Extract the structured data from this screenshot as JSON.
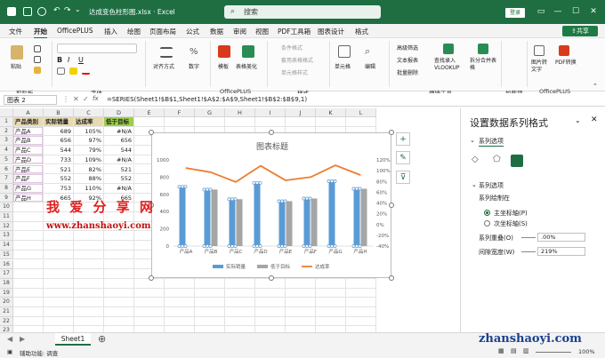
{
  "window": {
    "title": "达成变色柱形图.xlsx · Excel",
    "search_placeholder": "搜索",
    "login": "登录"
  },
  "menu": {
    "items": [
      "文件",
      "开始",
      "OfficePLUS",
      "插入",
      "绘图",
      "页面布局",
      "公式",
      "数据",
      "审阅",
      "视图",
      "PDF工具箱",
      "图表设计",
      "格式"
    ],
    "active": "开始",
    "share": "共享"
  },
  "ribbon": {
    "paste": "粘贴",
    "clipboard": "剪贴板",
    "font": "字体",
    "align": "对齐方式",
    "number": "数字",
    "template": "模板",
    "beautify": "表格美化",
    "officeplus": "OfficePLUS",
    "cond_format": "条件格式",
    "table_format": "套用表格格式",
    "cell_style": "单元格样式",
    "styles": "样式",
    "cells": "单元格",
    "edit": "编辑",
    "adv_filter": "高级筛选",
    "text_replace": "文本报表",
    "batch": "批量删除",
    "tools": "便捷工具",
    "vlookup": "查找录入 VLOOKUP",
    "split": "拆分合并表格",
    "addin": "加载项",
    "img_to_text": "图片转文字",
    "pdf_convert": "PDF转换",
    "officeplus2": "OfficePLUS"
  },
  "formula_bar": {
    "name_box": "图表 2",
    "fx": "fx",
    "formula": "=SERIES(Sheet1!$B$1,Sheet1!$A$2:$A$9,Sheet1!$B$2:$B$9,1)"
  },
  "grid": {
    "columns": [
      "A",
      "B",
      "C",
      "D",
      "E",
      "F",
      "G",
      "H",
      "I",
      "J",
      "K",
      "L"
    ],
    "rows": [
      "1",
      "2",
      "3",
      "4",
      "5",
      "6",
      "7",
      "8",
      "9",
      "10",
      "11",
      "12",
      "13",
      "14",
      "15",
      "16",
      "17",
      "18",
      "19",
      "20",
      "21",
      "22",
      "23"
    ],
    "header": [
      "产品类别",
      "实际销量",
      "达成率",
      "低于目标"
    ],
    "data": [
      [
        "产品A",
        "689",
        "105%",
        "#N/A"
      ],
      [
        "产品B",
        "656",
        "97%",
        "656"
      ],
      [
        "产品C",
        "544",
        "79%",
        "544"
      ],
      [
        "产品D",
        "733",
        "109%",
        "#N/A"
      ],
      [
        "产品E",
        "521",
        "82%",
        "521"
      ],
      [
        "产品F",
        "552",
        "88%",
        "552"
      ],
      [
        "产品G",
        "753",
        "110%",
        "#N/A"
      ],
      [
        "产品H",
        "665",
        "92%",
        "665"
      ]
    ]
  },
  "chart_data": {
    "type": "bar",
    "title": "图表标题",
    "categories": [
      "产品A",
      "产品B",
      "产品C",
      "产品D",
      "产品E",
      "产品F",
      "产品G",
      "产品H"
    ],
    "series": [
      {
        "name": "实际销量",
        "values": [
          689,
          656,
          544,
          733,
          521,
          552,
          753,
          665
        ],
        "color": "#5b9bd5",
        "type": "bar"
      },
      {
        "name": "低于目标",
        "values": [
          null,
          656,
          544,
          null,
          521,
          552,
          null,
          665
        ],
        "color": "#a5a5a5",
        "type": "bar"
      },
      {
        "name": "达成率",
        "values": [
          105,
          97,
          79,
          109,
          82,
          88,
          110,
          92
        ],
        "color": "#ed7d31",
        "type": "line",
        "axis": "secondary"
      }
    ],
    "ylim": [
      0,
      1000
    ],
    "yticks": [
      "0",
      "200",
      "400",
      "600",
      "800",
      "1000"
    ],
    "y2lim": [
      -40,
      120
    ],
    "y2ticks": [
      "-40%",
      "-20%",
      "0%",
      "20%",
      "40%",
      "60%",
      "80%",
      "100%",
      "120%"
    ],
    "legend": "bottom"
  },
  "watermark": {
    "cn": "我 爱 分 享 网",
    "url": "www.zhanshaoyi.com",
    "url2": "zhanshaoyi.com"
  },
  "pane": {
    "title": "设置数据系列格式",
    "options_label": "系列选项",
    "section": "系列选项",
    "plot_on": "系列绘制在",
    "primary": "主坐标轴(P)",
    "secondary": "次坐标轴(S)",
    "overlap_label": "系列重叠(O)",
    "overlap_value": ".00%",
    "gap_label": "间隙宽度(W)",
    "gap_value": "219%"
  },
  "sheet": {
    "tab": "Sheet1"
  },
  "status": {
    "left": "辅助功能: 调查",
    "zoom": "100%"
  },
  "colors": {
    "brand": "#1e6e42",
    "bar": "#5b9bd5",
    "gray": "#a5a5a5",
    "line": "#ed7d31"
  }
}
